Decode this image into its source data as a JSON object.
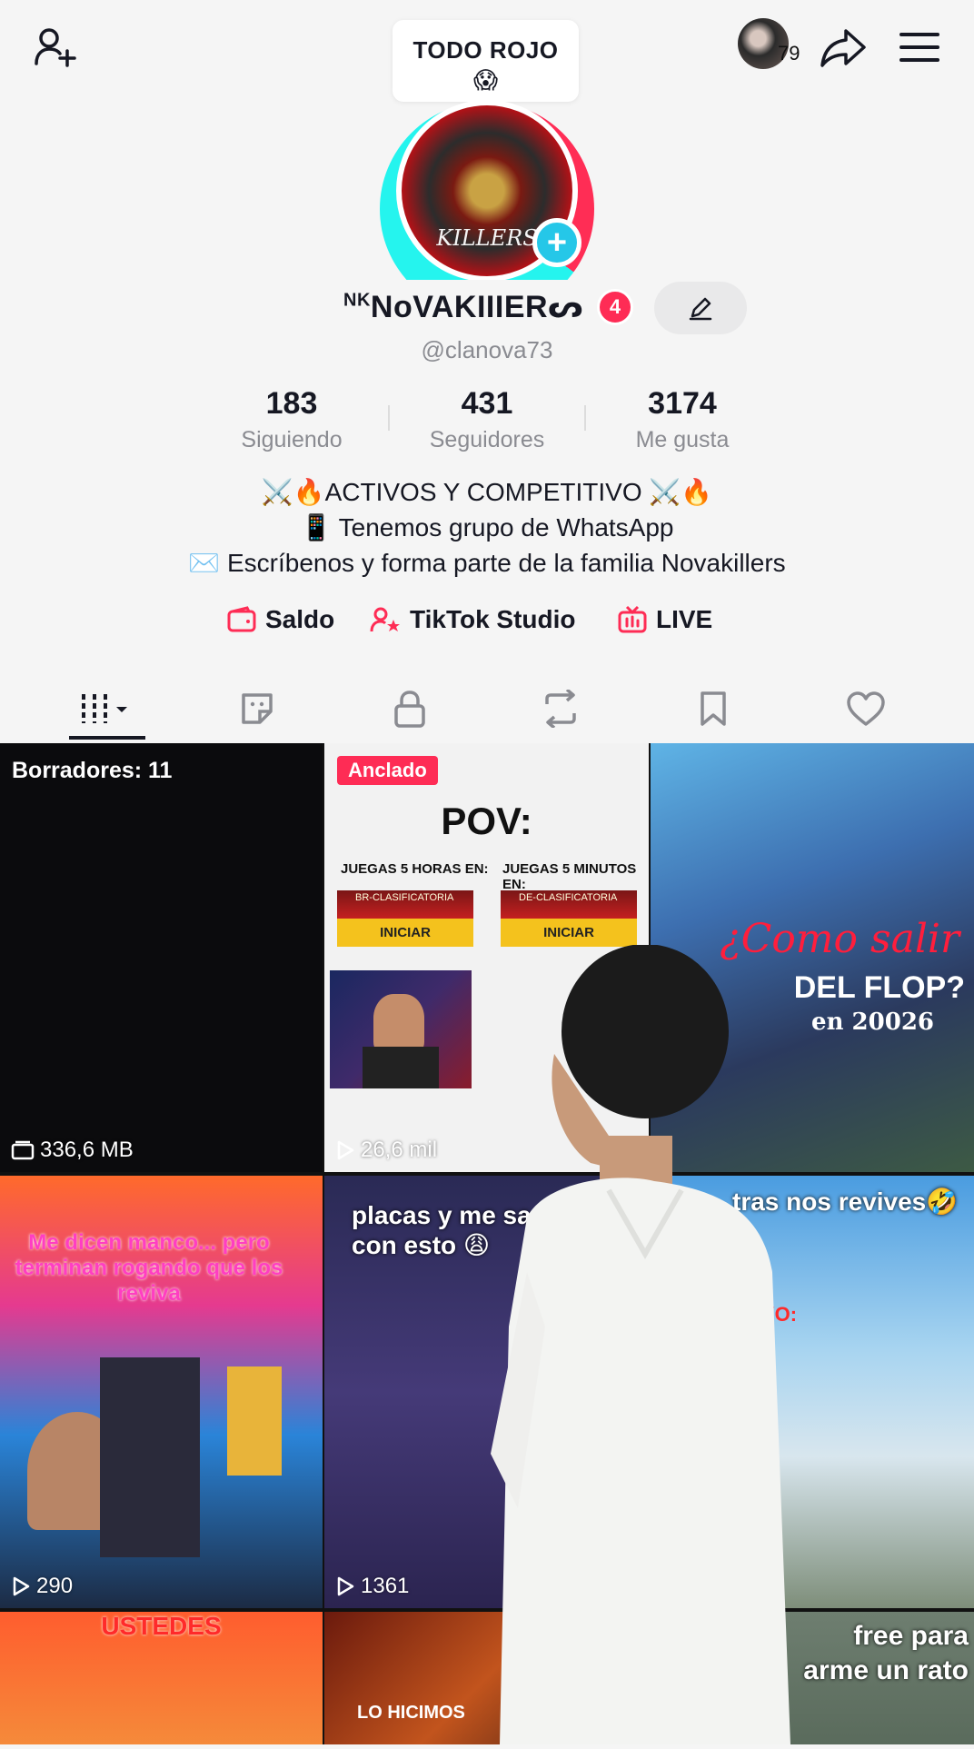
{
  "topbar": {
    "note_text": "TODO ROJO",
    "note_emoji": "😱",
    "follower_count_badge": "79"
  },
  "profile": {
    "avatar_text": "KILLERS",
    "display_name_prefix": "NK",
    "display_name": "NoVAKIIIERᔕ",
    "badge": "4",
    "handle": "@clanova73"
  },
  "stats": [
    {
      "value": "183",
      "label": "Siguiendo"
    },
    {
      "value": "431",
      "label": "Seguidores"
    },
    {
      "value": "3174",
      "label": "Me gusta"
    }
  ],
  "bio": {
    "line1": "⚔️🔥ACTIVOS Y COMPETITIVO ⚔️🔥",
    "line2": "📱 Tenemos grupo de WhatsApp",
    "line3": "✉️ Escríbenos y forma parte de la familia Novakillers"
  },
  "links": {
    "balance": "Saldo",
    "studio": "TikTok Studio",
    "live": "LIVE"
  },
  "grid": {
    "drafts_label": "Borradores: 11",
    "drafts_size": "336,6 MB",
    "pinned_label": "Anclado",
    "pov_title": "POV:",
    "pov_left_caption": "JUEGAS 5 HORAS EN:",
    "pov_right_caption": "JUEGAS 5 MINUTOS EN:",
    "pov_left_mode": "BR-CLASIFICATORIA",
    "pov_right_mode": "DE-CLASIFICATORIA",
    "pov_btn": "INICIAR",
    "pov_views": "26,6 mil",
    "flop_line1": "¿Como salir",
    "flop_line2": "DEL FLOP?",
    "flop_line3": "en 20026",
    "manco_text": "Me dicen manco... pero terminan rogando que los reviva",
    "manco_views": "290",
    "placas_text": "placas y me sa con esto 😩",
    "placas_views": "1361",
    "revives_text": "tras nos revives🤣",
    "revives_yo": "YO:",
    "ustedes_text": "USTEDES",
    "hicimos_text": "LO HICIMOS",
    "free_text": "free para arme un rato"
  }
}
